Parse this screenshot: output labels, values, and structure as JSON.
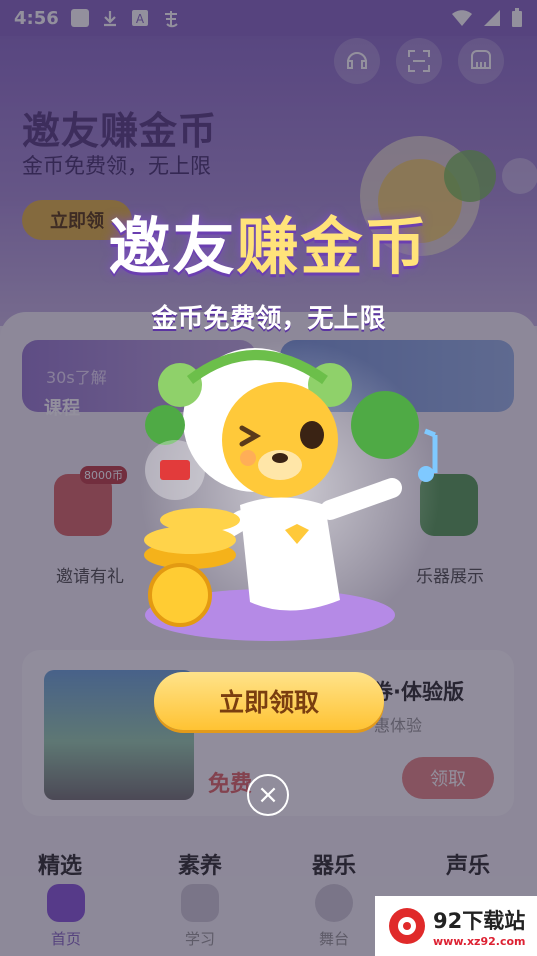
{
  "status_bar": {
    "time": "4:56"
  },
  "hero": {
    "title": "邀友赚金币",
    "subtitle": "金币免费领，无上限",
    "button": "立即领"
  },
  "features": {
    "card_a_small": "30s了解",
    "card_a_big": "课程"
  },
  "grid": {
    "item1": "邀请有礼",
    "item2": "乐器展示",
    "badge": "8000币"
  },
  "lesson": {
    "title": "券·体验版",
    "subtitle": "惠体验",
    "free": "免费",
    "button": "领取"
  },
  "categories": [
    "精选",
    "素养",
    "器乐",
    "声乐"
  ],
  "bottom_nav": [
    {
      "label": "首页"
    },
    {
      "label": "学习"
    },
    {
      "label": "舞台"
    }
  ],
  "popup": {
    "title_white": "邀友",
    "title_yellow": "赚金币",
    "subtitle": "金币免费领，无上限",
    "button": "立即领取",
    "close": "×"
  },
  "watermark": {
    "main": "92下载站",
    "url": "www.xz92.com"
  },
  "colors": {
    "purple": "#8a6cc4",
    "gold": "#ffc333",
    "bear": "#ffc93a"
  }
}
